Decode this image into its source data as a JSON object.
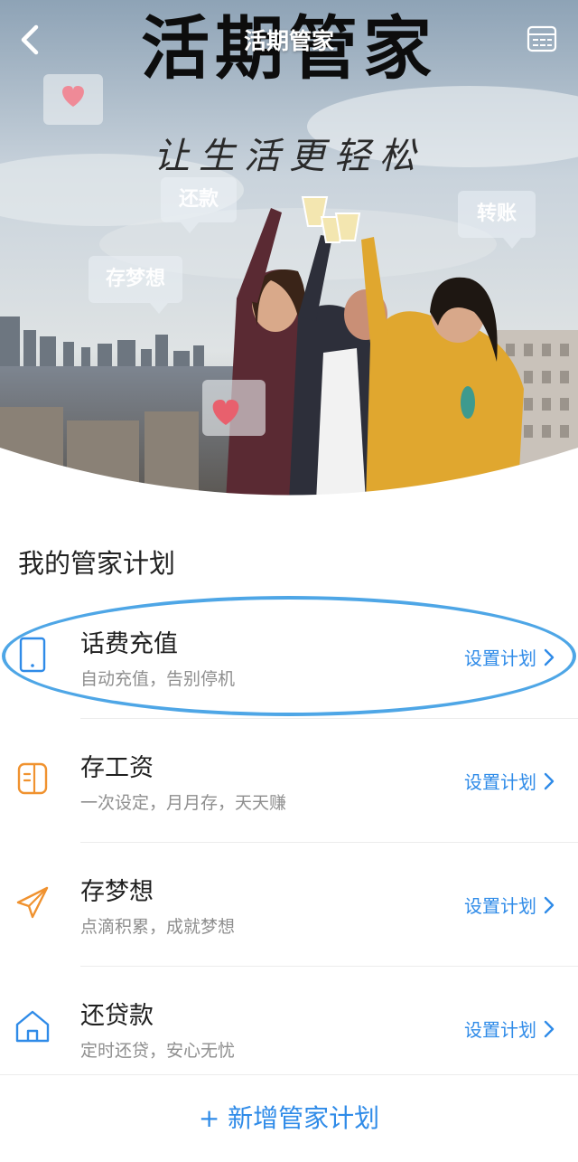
{
  "nav": {
    "title": "活期管家",
    "back_icon": "chevron-left-icon",
    "calendar_icon": "calendar-icon"
  },
  "hero": {
    "headline": "活期管家",
    "slogan": "让生活更轻松",
    "bubbles": [
      "还款",
      "转账",
      "存梦想"
    ]
  },
  "section": {
    "title": "我的管家计划"
  },
  "plans": [
    {
      "name": "话费充值",
      "desc": "自动充值，告别停机",
      "action": "设置计划",
      "icon": "phone-icon"
    },
    {
      "name": "存工资",
      "desc": "一次设定，月月存，天天赚",
      "action": "设置计划",
      "icon": "wallet-icon"
    },
    {
      "name": "存梦想",
      "desc": "点滴积累，成就梦想",
      "action": "设置计划",
      "icon": "paper-plane-icon"
    },
    {
      "name": "还贷款",
      "desc": "定时还贷，安心无忧",
      "action": "设置计划",
      "icon": "house-icon"
    }
  ],
  "bottom": {
    "add_label": "+ 新增管家计划"
  },
  "colors": {
    "accent": "#2f8be8",
    "orange": "#f0922f",
    "highlight": "#4ea6e6"
  }
}
